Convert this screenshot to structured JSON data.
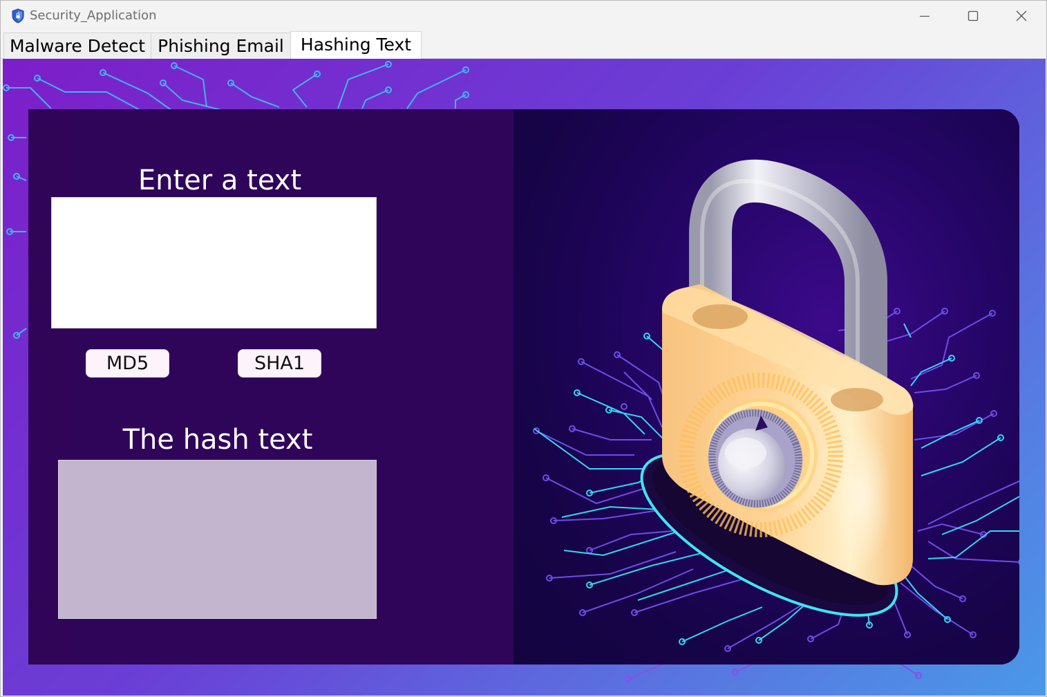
{
  "window": {
    "title": "Security_Application",
    "icon": "shield-icon",
    "controls": [
      "minimize-icon",
      "maximize-icon",
      "close-icon"
    ]
  },
  "tabs": [
    {
      "label": "Malware Detect",
      "selected": false
    },
    {
      "label": "Phishing Email",
      "selected": false
    },
    {
      "label": "Hashing Text",
      "selected": true
    }
  ],
  "hashing": {
    "input_label": "Enter a text",
    "input_value": "",
    "buttons": {
      "md5": "MD5",
      "sha1": "SHA1"
    },
    "output_label": "The hash text",
    "output_value": ""
  },
  "colors": {
    "background_gradient": [
      "#7c1ec9",
      "#4a98e8"
    ],
    "card_left": "#2f055a",
    "card_right": "#170449",
    "output_box": "#c2b5cd",
    "circuit_cyan": "#38d6f0",
    "circuit_violet": "#8a4de8"
  },
  "illustration": "padlock-icon"
}
